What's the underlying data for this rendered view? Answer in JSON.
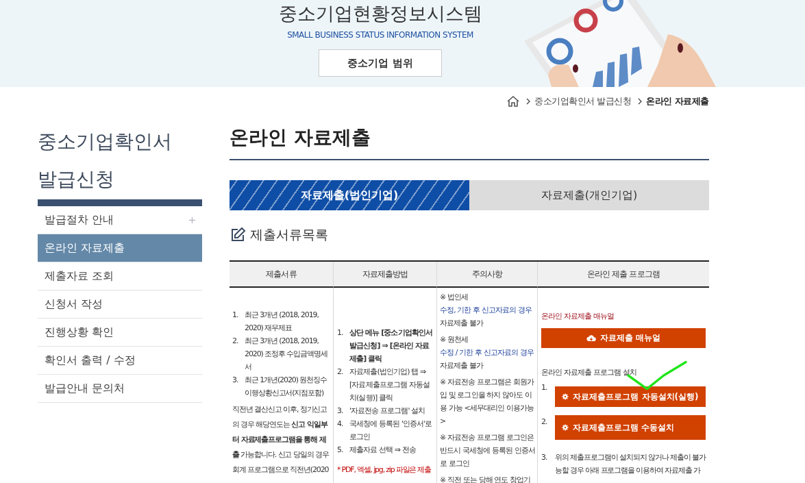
{
  "header": {
    "title": "중소기업현황정보시스템",
    "subtitle": "SMALL BUSINESS STATUS INFORMATION SYSTEM",
    "button": "중소기업 범위"
  },
  "breadcrumb": [
    "중소기업확인서 발급신청",
    "온라인 자료제출"
  ],
  "sidebar": {
    "title": "중소기업확인서 발급신청",
    "items": [
      {
        "label": "발급절차 안내",
        "selected": false,
        "has_submenu": true
      },
      {
        "label": "온라인 자료제출",
        "selected": true,
        "has_submenu": false
      },
      {
        "label": "제출자료 조회",
        "selected": false,
        "has_submenu": false
      },
      {
        "label": "신청서 작성",
        "selected": false,
        "has_submenu": false
      },
      {
        "label": "진행상황 확인",
        "selected": false,
        "has_submenu": false
      },
      {
        "label": "확인서 출력 / 수정",
        "selected": false,
        "has_submenu": false
      },
      {
        "label": "발급안내 문의처",
        "selected": false,
        "has_submenu": false
      }
    ]
  },
  "page_title": "온라인 자료제출",
  "tabs": [
    {
      "label": "자료제출(법인기업)",
      "selected": true
    },
    {
      "label": "자료제출(개인기업)",
      "selected": false
    }
  ],
  "section_title": "제출서류목록",
  "table": {
    "columns": [
      "제출서류",
      "자료제출방법",
      "주의사항",
      "온라인 제출 프로그램"
    ],
    "documents": {
      "items": [
        {
          "number": "1.",
          "text": "최근 3개년 (2018, 2019, 2020) 재무제표"
        },
        {
          "number": "2.",
          "text": "최근 3개년 (2018, 2019, 2020) 조정후 수입금액명세서"
        },
        {
          "number": "3.",
          "text": "최근 1개년(2020) 원천징수 이행상황신고서(지점포함)"
        }
      ],
      "note": "직전년 결산신고 이후, 정기신고의 경우 해당연도는 **신고 익일부터 자료제출프로그램을 통해 제출** 가능합니다. 신고 당일의 경우 회계 프로그램으로 직전년(2020"
    },
    "method": {
      "steps": [
        {
          "number": "1.",
          "text": "상단 메뉴 [중소기업확인서 발급신청] ⇒ [온라인 자료제출] 클릭",
          "bold": true
        },
        {
          "number": "2.",
          "text": "자료제출(법인기업) 탭 ⇒ [자료제출프로그램 자동설치(실행)] 클릭",
          "bold": false
        },
        {
          "number": "3.",
          "text": "'자료전송 프로그램' 설치",
          "bold": false
        },
        {
          "number": "4.",
          "text": "국세청에 등록된 '인증서'로 로그인",
          "bold": false
        },
        {
          "number": "5.",
          "text": "제출자료 선택 ⇒ 전송",
          "bold": false
        }
      ],
      "note": "* PDF, 엑셀, jpg, zip 파일은 제출"
    },
    "cautions": [
      [
        {
          "text": "※ 법인세",
          "kind": "plain"
        },
        {
          "text": "수정, 기한 후 신고자료의 경우",
          "kind": "highlight"
        },
        {
          "text": "자료제출 불가",
          "kind": "plain"
        }
      ],
      [
        {
          "text": "※ 원천세",
          "kind": "plain"
        },
        {
          "text": "수정 / 기한 후 신고자료의 경우",
          "kind": "highlight"
        },
        {
          "text": "자료제출 불가",
          "kind": "plain"
        }
      ],
      [
        {
          "text": "※ 자료전송 프로그램은 회원가입 및 로그인을 하지 않아도 이용 가능 <세무대리인 이용가능>",
          "kind": "plain"
        }
      ],
      [
        {
          "text": "※ 자료전송 프로그램 로그인은 반드시 국세청에 등록된 인증서로 로그인",
          "kind": "plain"
        }
      ],
      [
        {
          "text": "※ 직전 또는 당해 연도 창업기",
          "kind": "plain"
        }
      ]
    ],
    "program": {
      "manual_label": "온라인 자료제출 매뉴얼",
      "manual_button": "자료제출 매뉴얼",
      "install_label": "온라인 자료제출 프로그램 설치",
      "install_buttons": [
        {
          "number": "1.",
          "label": "자료제출프로그램 자동설치(실행)"
        },
        {
          "number": "2.",
          "label": "자료제출프로그램 수동설치"
        }
      ],
      "step": {
        "number": "3.",
        "text": "위의 제출프로그램이 설치되지 않거나 제출이 불가능할 경우 아래 프로그램을 이용하여 자료제출 가"
      },
      "annotations": [
        {
          "kind": "check"
        }
      ]
    }
  }
}
